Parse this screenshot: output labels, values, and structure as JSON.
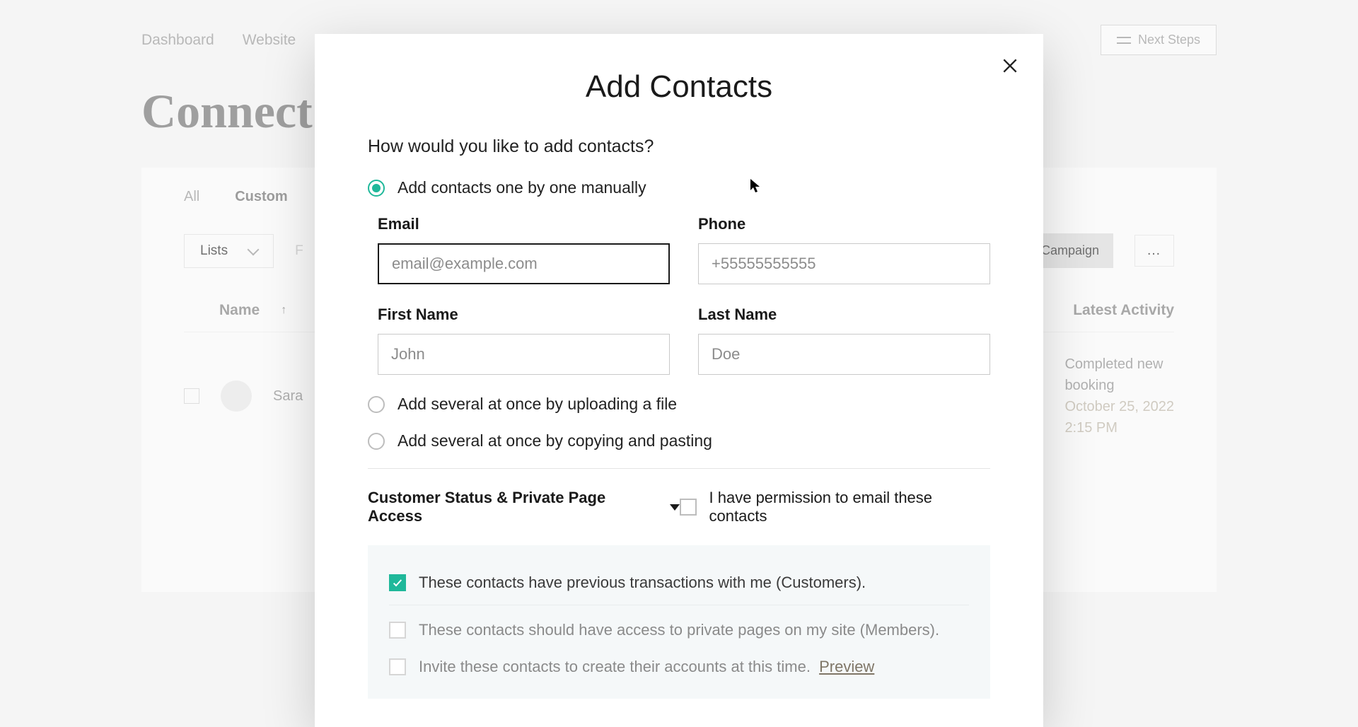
{
  "nav": {
    "items": [
      "Dashboard",
      "Website"
    ],
    "next_steps": "Next Steps"
  },
  "page": {
    "title": "Connect"
  },
  "tabs": {
    "tab_all": "All",
    "tab_customers": "Custom",
    "lists_label": "Lists"
  },
  "toolbar": {
    "campaign": "nd Campaign",
    "more": "…"
  },
  "table": {
    "col_name": "Name",
    "col_name_sort": "↑",
    "col_activity": "Latest Activity",
    "row_name": "Sara",
    "activity_line1": "Completed new",
    "activity_line2": "booking",
    "activity_date": "October 25, 2022",
    "activity_time": "2:15 PM"
  },
  "modal": {
    "title": "Add Contacts",
    "question": "How would you like to add contacts?",
    "options": {
      "manual": "Add contacts one by one manually",
      "upload": "Add several at once by uploading a file",
      "paste": "Add several at once by copying and pasting"
    },
    "fields": {
      "email_label": "Email",
      "email_placeholder": "email@example.com",
      "phone_label": "Phone",
      "phone_placeholder": "+55555555555",
      "first_name_label": "First Name",
      "first_name_placeholder": "John",
      "last_name_label": "Last Name",
      "last_name_placeholder": "Doe"
    },
    "status_section": "Customer Status & Private Page Access",
    "permission_label": "I have permission to email these contacts",
    "panel": {
      "customers": "These contacts have previous transactions with me (Customers).",
      "members": "These contacts should have access to private pages on my site (Members).",
      "invite": "Invite these contacts to create their accounts at this time.",
      "preview": "Preview"
    }
  }
}
